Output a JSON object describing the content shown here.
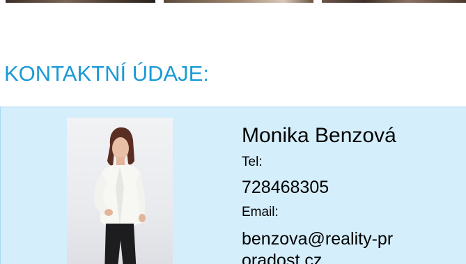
{
  "section": {
    "title": "KONTAKTNÍ ÚDAJE:"
  },
  "contact": {
    "name": "Monika Benzová",
    "tel_label": "Tel:",
    "phone": "728468305",
    "email_label": "Email:",
    "email": "benzova@reality-proradost.cz"
  },
  "colors": {
    "title": "#1a9ad6",
    "card_background": "#d4eefb",
    "card_border": "#a9d9f1"
  }
}
